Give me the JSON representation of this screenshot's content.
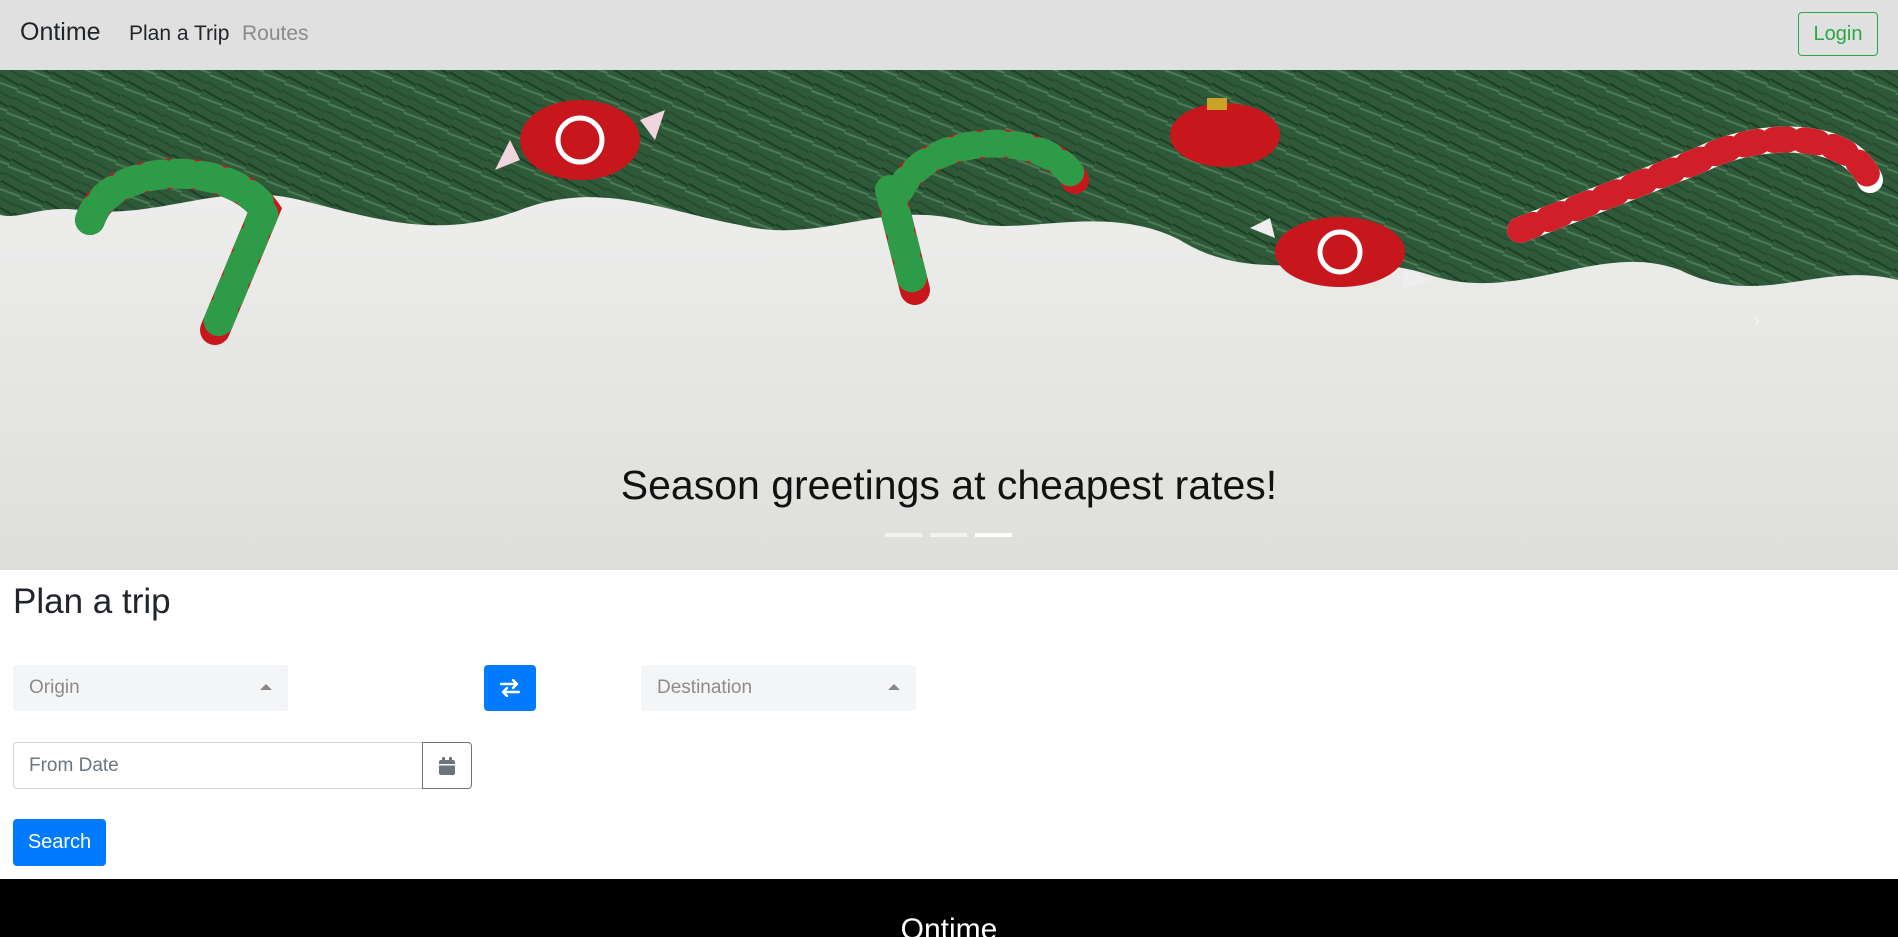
{
  "navbar": {
    "brand": "Ontime",
    "links": [
      {
        "label": "Plan a Trip",
        "active": true
      },
      {
        "label": "Routes",
        "active": false
      }
    ],
    "login_label": "Login"
  },
  "carousel": {
    "caption": "Season greetings at cheapest rates!",
    "slide_count": 3,
    "active_slide": 3
  },
  "plan": {
    "title": "Plan a trip",
    "origin_placeholder": "Origin",
    "destination_placeholder": "Destination",
    "from_date_placeholder": "From Date",
    "search_label": "Search"
  },
  "footer": {
    "brand": "Ontime"
  },
  "colors": {
    "primary": "#007bff",
    "success": "#28a745",
    "navbar_bg": "#e0e0e0",
    "footer_bg": "#000000"
  },
  "icons": {
    "swap": "exchange-icon",
    "calendar": "calendar-icon",
    "dropdown": "caret-up-icon"
  }
}
